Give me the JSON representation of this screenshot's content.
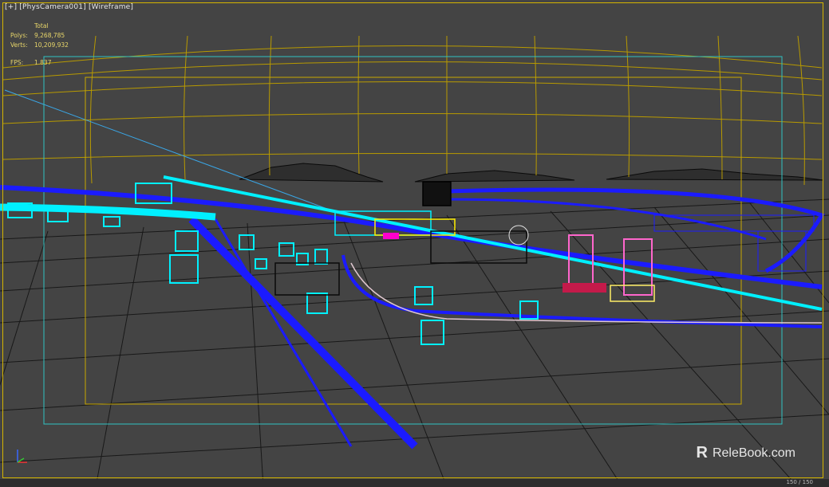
{
  "viewport": {
    "label_plus": "[+]",
    "label_camera": "[PhysCamera001]",
    "label_mode": "[Wireframe]"
  },
  "stats": {
    "header": "Total",
    "polys_label": "Polys:",
    "polys_value": "9,268,785",
    "verts_label": "Verts:",
    "verts_value": "10,209,932",
    "fps_label": "FPS:",
    "fps_value": "1.837"
  },
  "watermark": {
    "logo": "R",
    "text": "ReleBook.com"
  },
  "status": {
    "frame_counter": "150 / 150"
  },
  "colors": {
    "viewport_bg": "#444444",
    "frame_border": "#d4b400",
    "safe_frame": "#2fc2c2",
    "wire_blue": "#1b1bff",
    "wire_cyan": "#00f0ff",
    "stats_text": "#e8d66a"
  }
}
